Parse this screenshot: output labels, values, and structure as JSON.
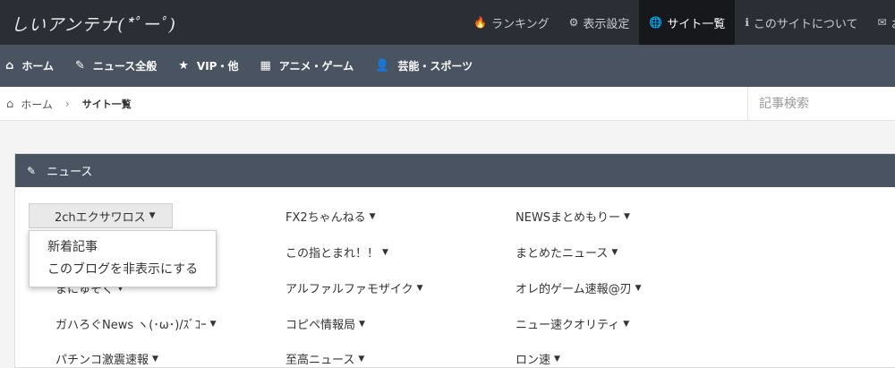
{
  "logo": "しいアンテナ(*ﾟーﾟ)",
  "topnav": [
    {
      "icon": "fire-icon",
      "glyph": "🔥",
      "label": "ランキング"
    },
    {
      "icon": "gear-icon",
      "glyph": "⚙",
      "label": "表示設定"
    },
    {
      "icon": "globe-icon",
      "glyph": "🌐",
      "label": "サイト一覧",
      "active": true
    },
    {
      "icon": "info-icon",
      "glyph": "ℹ",
      "label": "このサイトについて"
    },
    {
      "icon": "envelope-icon",
      "glyph": "✉",
      "label": "お問"
    }
  ],
  "categories": [
    {
      "icon": "home-icon",
      "glyph": "⌂",
      "label": "ホーム"
    },
    {
      "icon": "pencil-icon",
      "glyph": "✎",
      "label": "ニュース全般"
    },
    {
      "icon": "star-icon",
      "glyph": "★",
      "label": "VIP・他"
    },
    {
      "icon": "film-icon",
      "glyph": "▦",
      "label": "アニメ・ゲーム"
    },
    {
      "icon": "user-icon",
      "glyph": "👤",
      "label": "芸能・スポーツ"
    }
  ],
  "breadcrumb": {
    "home": "ホーム",
    "separator": "›",
    "current": "サイト一覧"
  },
  "search": {
    "placeholder": "記事検索",
    "value": ""
  },
  "panel": {
    "title": "ニュース",
    "icon": "pencil-icon",
    "glyph": "✎"
  },
  "sites": {
    "col1": [
      "2chエクサワロス",
      "",
      "まにゅそく",
      "ガハろぐNews ヽ(･ω･)/ｽﾞｺｰ",
      "パチンコ激震速報"
    ],
    "col2": [
      "FX2ちゃんねる",
      "この指とまれ！！",
      "アルファルファモザイク",
      "コピペ情報局",
      "至高ニュース"
    ],
    "col3": [
      "NEWSまとめもりー",
      "まとめたニュース",
      "オレ的ゲーム速報@刃",
      "ニュー速クオリティ",
      "ロン速"
    ]
  },
  "dropdown": [
    "新着記事",
    "このブログを非表示にする"
  ],
  "caret": "▼"
}
